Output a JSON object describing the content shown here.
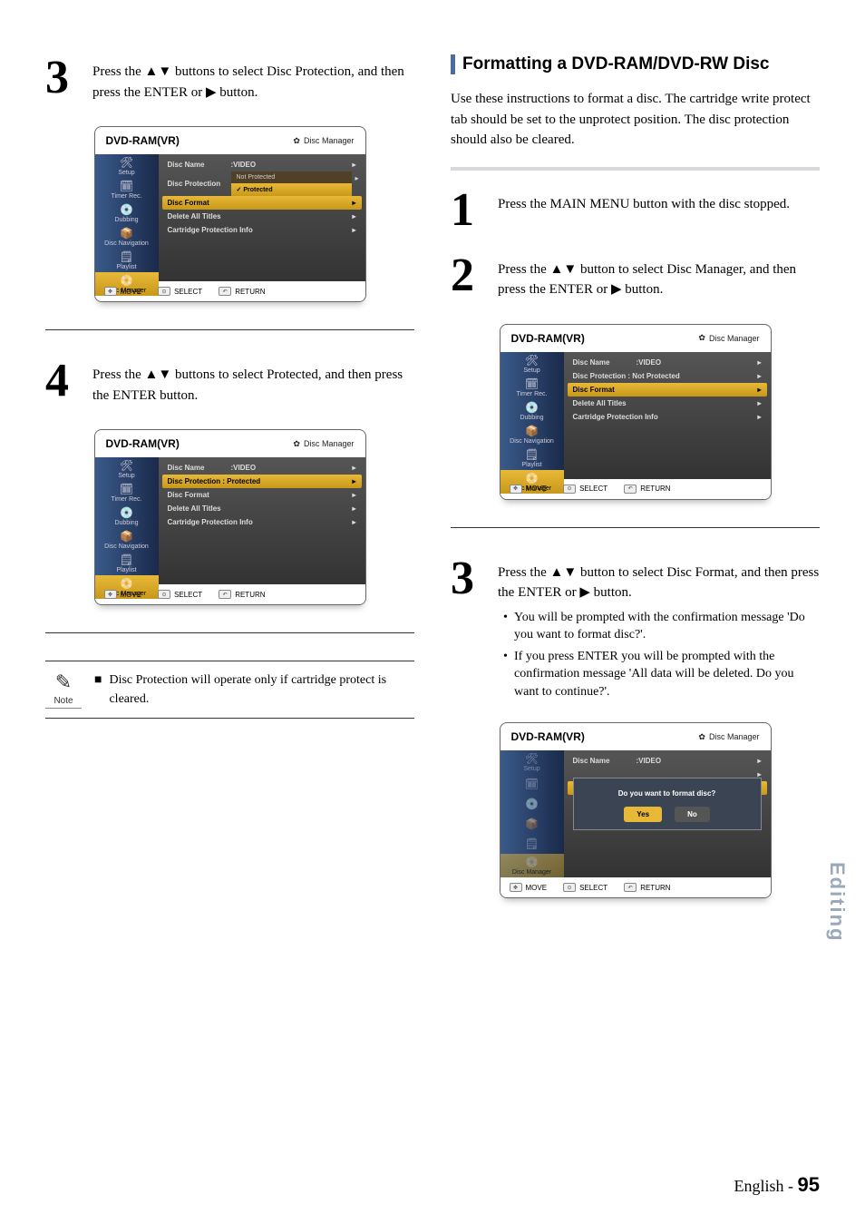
{
  "left": {
    "step3": {
      "num": "3",
      "text": "Press the ▲▼ buttons to select Disc Protection, and then press the ENTER or ▶ button."
    },
    "step4": {
      "num": "4",
      "text": "Press the ▲▼ buttons to select Protected, and then press the ENTER button."
    },
    "note": {
      "label": "Note",
      "text": "Disc Protection will operate only if cartridge protect is cleared."
    }
  },
  "right": {
    "section_title": "Formatting a DVD-RAM/DVD-RW Disc",
    "intro": "Use these instructions to format a disc. The cartridge write protect tab should be set to the unprotect position. The disc protection should also be cleared.",
    "step1": {
      "num": "1",
      "text": "Press the MAIN MENU button with the disc stopped."
    },
    "step2": {
      "num": "2",
      "text": "Press the ▲▼ button to select Disc Manager, and then press the ENTER or ▶ button."
    },
    "step3": {
      "num": "3",
      "text": "Press the ▲▼ button to select Disc Format, and then press the ENTER or ▶ button.",
      "bullets": [
        "You will be prompted with the confirmation message 'Do you want to format disc?'.",
        "If you press ENTER you will be prompted with the confirmation message 'All data will be deleted. Do you want to continue?'."
      ]
    }
  },
  "osd_common": {
    "header_title": "DVD-RAM(VR)",
    "header_sub": "Disc Manager",
    "footer": {
      "move": "MOVE",
      "select": "SELECT",
      "return": "RETURN"
    },
    "sidebar": [
      "Setup",
      "Timer Rec.",
      "Dubbing",
      "Disc Navigation",
      "Playlist",
      "Disc Manager"
    ]
  },
  "osd1": {
    "rows": {
      "name_label": "Disc Name",
      "name_value": ":VIDEO",
      "protection_label": "Disc  Protection",
      "format_label": "Disc Format",
      "delete_label": "Delete All Titles",
      "cart_label": "Cartridge Protection Info"
    },
    "sub": {
      "not_protected": "Not Protected",
      "protected": "Protected"
    }
  },
  "osd2": {
    "rows": {
      "name_label": "Disc Name",
      "name_value": ":VIDEO",
      "protection_label": "Disc  Protection : Protected",
      "format_label": "Disc Format",
      "delete_label": "Delete All Titles",
      "cart_label": "Cartridge Protection Info"
    }
  },
  "osd3": {
    "rows": {
      "name_label": "Disc Name",
      "name_value": ":VIDEO",
      "protection_label": "Disc  Protection : Not Protected",
      "format_label": "Disc Format",
      "delete_label": "Delete All Titles",
      "cart_label": "Cartridge Protection Info"
    }
  },
  "osd4": {
    "rows": {
      "name_label": "Disc Name",
      "name_value": ":VIDEO"
    },
    "dialog": {
      "text": "Do you want to format disc?",
      "yes": "Yes",
      "no": "No"
    }
  },
  "side_tab": "Editing",
  "footer": {
    "lang": "English",
    "dash": " - ",
    "num": "95"
  }
}
